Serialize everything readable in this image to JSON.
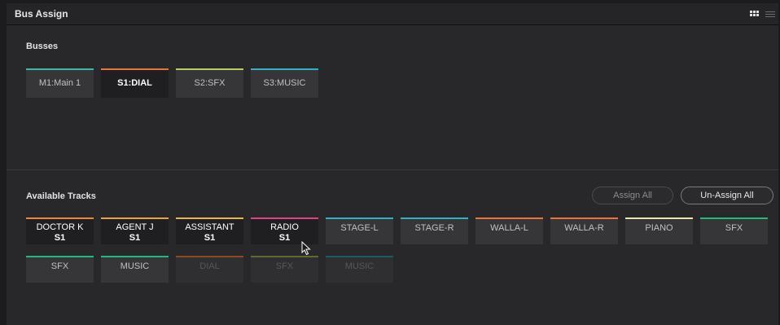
{
  "window": {
    "title": "Bus Assign"
  },
  "toolbar": {
    "grid_icon": "grid-view-icon",
    "list_icon": "list-view-icon"
  },
  "busses": {
    "label": "Busses",
    "items": [
      {
        "name": "M1:Main 1",
        "color": "#3fb6a6",
        "state": "normal"
      },
      {
        "name": "S1:DIAL",
        "color": "#e5763a",
        "state": "selected"
      },
      {
        "name": "S2:SFX",
        "color": "#b6cf63",
        "state": "normal"
      },
      {
        "name": "S3:MUSIC",
        "color": "#2fb3c0",
        "state": "normal"
      }
    ]
  },
  "tracks": {
    "label": "Available Tracks",
    "assign_all_label": "Assign All",
    "unassign_all_label": "Un-Assign All",
    "items": [
      {
        "name": "DOCTOR K",
        "bus": "S1",
        "color": "#e8893a",
        "state": "selected"
      },
      {
        "name": "AGENT J",
        "bus": "S1",
        "color": "#e8a63a",
        "state": "selected"
      },
      {
        "name": "ASSISTANT",
        "bus": "S1",
        "color": "#e8b84a",
        "state": "selected"
      },
      {
        "name": "RADIO",
        "bus": "S1",
        "color": "#e0408a",
        "state": "selected"
      },
      {
        "name": "STAGE-L",
        "bus": "",
        "color": "#2fb3c0",
        "state": "normal"
      },
      {
        "name": "STAGE-R",
        "bus": "",
        "color": "#2fb3c0",
        "state": "normal"
      },
      {
        "name": "WALLA-L",
        "bus": "",
        "color": "#e5763a",
        "state": "normal"
      },
      {
        "name": "WALLA-R",
        "bus": "",
        "color": "#e5763a",
        "state": "normal"
      },
      {
        "name": "PIANO",
        "bus": "",
        "color": "#efe3b0",
        "state": "normal"
      },
      {
        "name": "SFX",
        "bus": "",
        "color": "#25b87e",
        "state": "normal"
      },
      {
        "name": "SFX",
        "bus": "",
        "color": "#25b87e",
        "state": "normal"
      },
      {
        "name": "MUSIC",
        "bus": "",
        "color": "#25b87e",
        "state": "normal"
      },
      {
        "name": "DIAL",
        "bus": "",
        "color": "#8a4a26",
        "state": "dim"
      },
      {
        "name": "SFX",
        "bus": "",
        "color": "#5f6a33",
        "state": "dim"
      },
      {
        "name": "MUSIC",
        "bus": "",
        "color": "#1d5a62",
        "state": "dim"
      }
    ]
  }
}
